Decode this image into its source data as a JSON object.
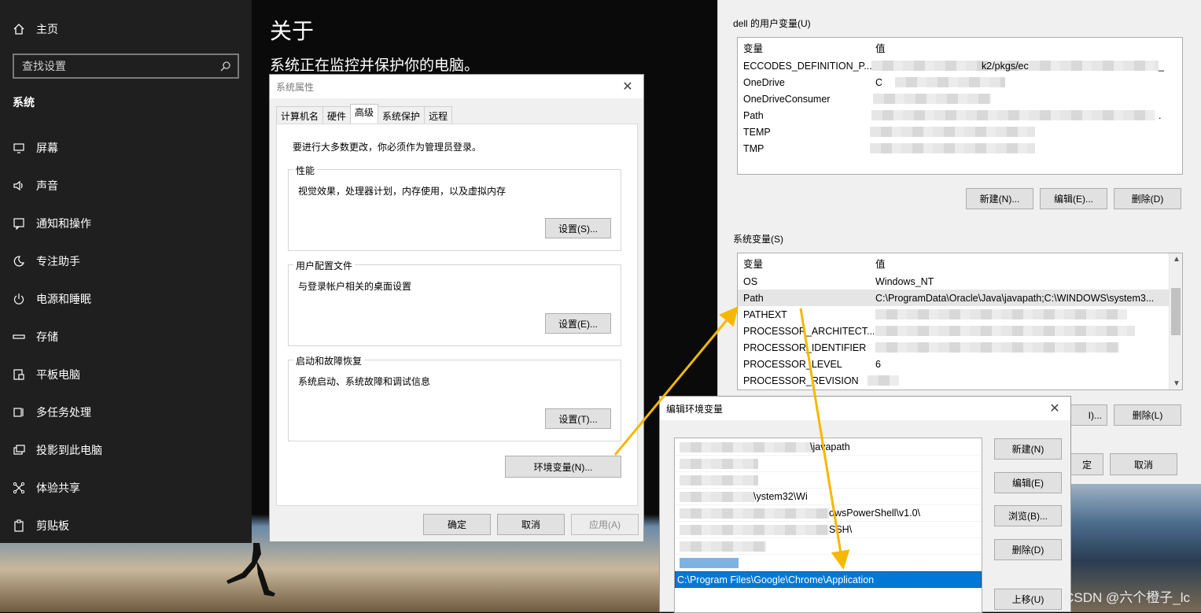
{
  "settings": {
    "home_label": "主页",
    "search_placeholder": "查找设置",
    "section_label": "系统",
    "nav_items": [
      {
        "icon": "monitor-icon",
        "label": "屏幕"
      },
      {
        "icon": "speaker-icon",
        "label": "声音"
      },
      {
        "icon": "notification-icon",
        "label": "通知和操作"
      },
      {
        "icon": "moon-icon",
        "label": "专注助手"
      },
      {
        "icon": "power-icon",
        "label": "电源和睡眠"
      },
      {
        "icon": "storage-icon",
        "label": "存储"
      },
      {
        "icon": "tablet-icon",
        "label": "平板电脑"
      },
      {
        "icon": "multitask-icon",
        "label": "多任务处理"
      },
      {
        "icon": "project-icon",
        "label": "投影到此电脑"
      },
      {
        "icon": "share-icon",
        "label": "体验共享"
      },
      {
        "icon": "clipboard-icon",
        "label": "剪贴板"
      }
    ]
  },
  "about": {
    "title": "关于",
    "subtitle": "系统正在监控并保护你的电脑。"
  },
  "sysprops": {
    "title": "系统属性",
    "tabs": [
      "计算机名",
      "硬件",
      "高级",
      "系统保护",
      "远程"
    ],
    "active_tab": "高级",
    "notice": "要进行大多数更改，你必须作为管理员登录。",
    "performance": {
      "legend": "性能",
      "desc": "视觉效果，处理器计划，内存使用，以及虚拟内存",
      "button": "设置(S)..."
    },
    "profile": {
      "legend": "用户配置文件",
      "desc": "与登录帐户相关的桌面设置",
      "button": "设置(E)..."
    },
    "startup": {
      "legend": "启动和故障恢复",
      "desc": "系统启动、系统故障和调试信息",
      "button": "设置(T)..."
    },
    "env_button": "环境变量(N)...",
    "ok": "确定",
    "cancel": "取消",
    "apply": "应用(A)"
  },
  "envvars": {
    "user_group": "dell 的用户变量(U)",
    "col_var": "变量",
    "col_val": "值",
    "user_rows": [
      {
        "name": "ECCODES_DEFINITION_P...",
        "value": "k2/pkgs/ec",
        "value_tail": "_"
      },
      {
        "name": "OneDrive",
        "value": "C"
      },
      {
        "name": "OneDriveConsumer",
        "value": ""
      },
      {
        "name": "Path",
        "value": "",
        "value_tail": "."
      },
      {
        "name": "TEMP",
        "value": ""
      },
      {
        "name": "TMP",
        "value": ""
      }
    ],
    "user_new": "新建(N)...",
    "user_edit": "编辑(E)...",
    "user_delete": "删除(D)",
    "system_group": "系统变量(S)",
    "system_rows": [
      {
        "name": "OS",
        "value": "Windows_NT"
      },
      {
        "name": "Path",
        "value": "C:\\ProgramData\\Oracle\\Java\\javapath;C:\\WINDOWS\\system3..."
      },
      {
        "name": "PATHEXT",
        "value": ""
      },
      {
        "name": "PROCESSOR_ARCHITECT...",
        "value": ""
      },
      {
        "name": "PROCESSOR_IDENTIFIER",
        "value": ""
      },
      {
        "name": "PROCESSOR_LEVEL",
        "value": "6"
      },
      {
        "name": "PROCESSOR_REVISION",
        "value": ""
      }
    ],
    "sys_edit_partial": "I)...",
    "sys_delete": "删除(L)",
    "ok_partial": "定",
    "cancel": "取消"
  },
  "editenv": {
    "title": "编辑环境变量",
    "rows": [
      {
        "text": "\\javapath"
      },
      {
        "text": ""
      },
      {
        "text": ""
      },
      {
        "text": "\\ystem32\\Wi"
      },
      {
        "text": "owsPowerShell\\v1.0\\"
      },
      {
        "text": "SSH\\"
      },
      {
        "text": ""
      },
      {
        "text": ""
      },
      {
        "text": "C:\\Program Files\\Google\\Chrome\\Application"
      }
    ],
    "selected_index": 8,
    "buttons": {
      "new": "新建(N)",
      "edit": "编辑(E)",
      "browse": "浏览(B)...",
      "delete": "删除(D)",
      "move_up": "上移(U)"
    }
  },
  "watermark": "CSDN @六个橙子_lc",
  "colors": {
    "accent": "#0078d7",
    "arrow": "#f5b800"
  }
}
